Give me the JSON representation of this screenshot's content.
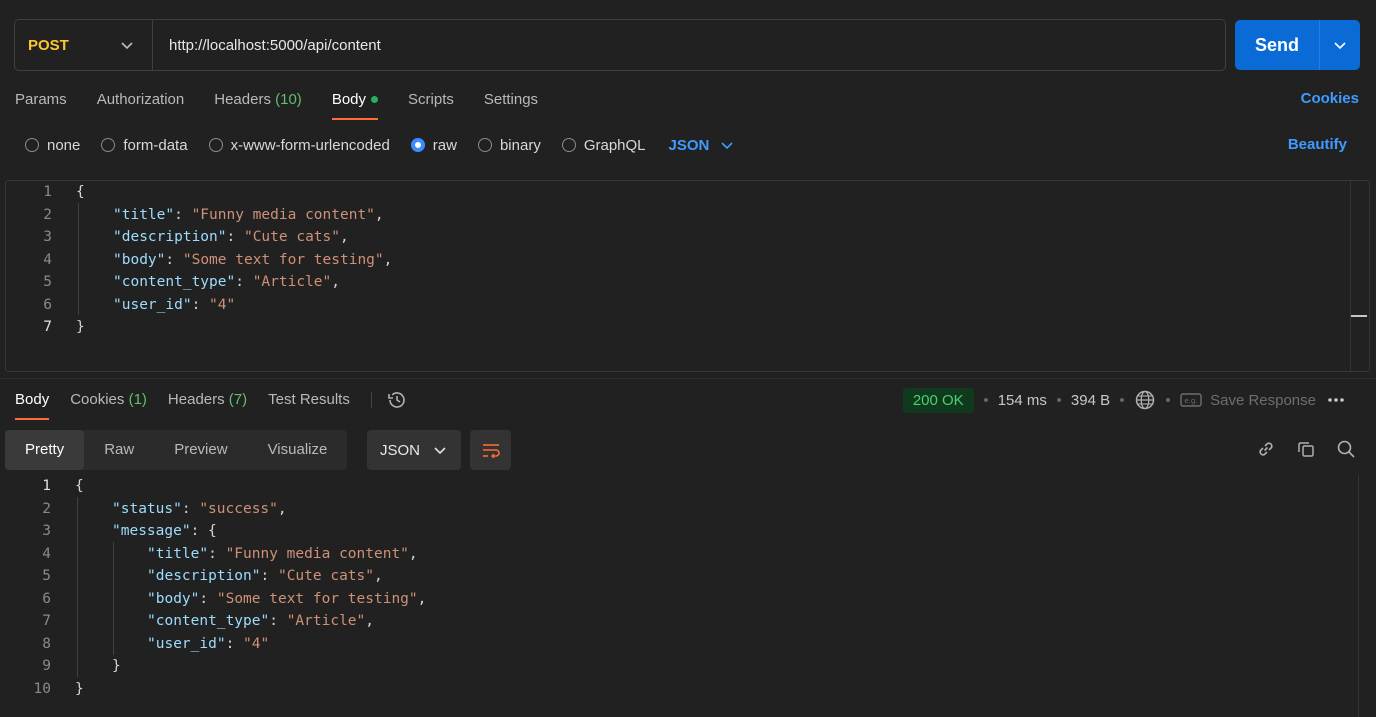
{
  "request": {
    "method": "POST",
    "url": "http://localhost:5000/api/content",
    "send_label": "Send"
  },
  "tabs": {
    "params": "Params",
    "authorization": "Authorization",
    "headers": "Headers",
    "headers_count": "(10)",
    "body": "Body",
    "scripts": "Scripts",
    "settings": "Settings",
    "cookies": "Cookies"
  },
  "body_options": {
    "none": "none",
    "form_data": "form-data",
    "urlencoded": "x-www-form-urlencoded",
    "raw": "raw",
    "binary": "binary",
    "graphql": "GraphQL",
    "language": "JSON",
    "beautify": "Beautify"
  },
  "request_body": {
    "lines": [
      "1",
      "2",
      "3",
      "4",
      "5",
      "6",
      "7"
    ],
    "open": "{",
    "close": "}",
    "fields": [
      {
        "key": "\"title\"",
        "value": "\"Funny media content\"",
        "sep": ": ",
        "end": ","
      },
      {
        "key": "\"description\"",
        "value": "\"Cute cats\"",
        "sep": ": ",
        "end": ","
      },
      {
        "key": "\"body\"",
        "value": "\"Some text for testing\"",
        "sep": ": ",
        "end": ","
      },
      {
        "key": "\"content_type\"",
        "value": "\"Article\"",
        "sep": ": ",
        "end": ","
      },
      {
        "key": "\"user_id\"",
        "value": "\"4\"",
        "sep": ": ",
        "end": ""
      }
    ]
  },
  "response_tabs": {
    "body": "Body",
    "cookies": "Cookies",
    "cookies_count": "(1)",
    "headers": "Headers",
    "headers_count": "(7)",
    "test_results": "Test Results"
  },
  "response_meta": {
    "status": "200 OK",
    "time": "154 ms",
    "size": "394 B",
    "save_response": "Save Response",
    "status_color": "#4cd071"
  },
  "view_modes": {
    "pretty": "Pretty",
    "raw": "Raw",
    "preview": "Preview",
    "visualize": "Visualize",
    "format": "JSON"
  },
  "response_body": {
    "lines": [
      "1",
      "2",
      "3",
      "4",
      "5",
      "6",
      "7",
      "8",
      "9",
      "10"
    ],
    "open": "{",
    "close": "}",
    "status_key": "\"status\"",
    "status_value": "\"success\"",
    "message_key": "\"message\"",
    "inner_open": "{",
    "inner_close": "}",
    "fields": [
      {
        "key": "\"title\"",
        "value": "\"Funny media content\"",
        "sep": ": ",
        "end": ","
      },
      {
        "key": "\"description\"",
        "value": "\"Cute cats\"",
        "sep": ": ",
        "end": ","
      },
      {
        "key": "\"body\"",
        "value": "\"Some text for testing\"",
        "sep": ": ",
        "end": ","
      },
      {
        "key": "\"content_type\"",
        "value": "\"Article\"",
        "sep": ": ",
        "end": ","
      },
      {
        "key": "\"user_id\"",
        "value": "\"4\"",
        "sep": ": ",
        "end": ""
      }
    ]
  },
  "colors": {
    "accent": "#ff6c37",
    "primary": "#0a6bd7",
    "link": "#3f9bff",
    "method": "#ffc52d"
  }
}
